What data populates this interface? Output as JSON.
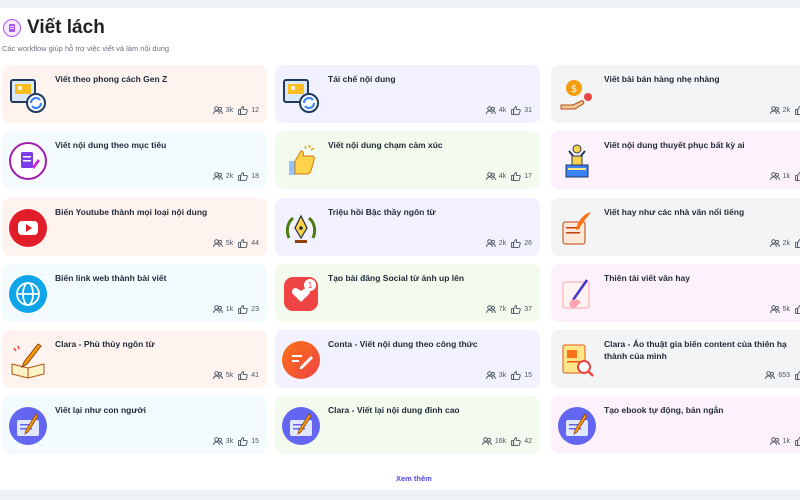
{
  "header": {
    "title": "Viết lách",
    "subtitle": "Các workflow giúp hỗ trợ việc viết và làm nội dung"
  },
  "cards": [
    {
      "title": "Viết theo phong cách Gen Z",
      "users": "3k",
      "likes": "12",
      "bg": "#fff3f0",
      "icon": "video-recycle-icon"
    },
    {
      "title": "Tái chế nội dung",
      "users": "4k",
      "likes": "31",
      "bg": "#f2f1ff",
      "icon": "video-recycle-icon"
    },
    {
      "title": "Viết bài bán hàng nhẹ nhàng",
      "users": "2k",
      "likes": "",
      "bg": "#f3f4f6",
      "icon": "money-hand-icon"
    },
    {
      "title": "Viết nội dung theo mục tiêu",
      "users": "2k",
      "likes": "18",
      "bg": "#f3fbff",
      "icon": "document-edit-icon"
    },
    {
      "title": "Viết nội dung chạm cảm xúc",
      "users": "4k",
      "likes": "17",
      "bg": "#f2fbee",
      "icon": "thumbs-up-icon"
    },
    {
      "title": "Viết nội dung thuyết phục bất kỳ ai",
      "users": "1k",
      "likes": "",
      "bg": "#fdf1fb",
      "icon": "speaker-podium-icon"
    },
    {
      "title": "Biến Youtube thành mọi loại nội dung",
      "users": "5k",
      "likes": "44",
      "bg": "#fff3f0",
      "icon": "youtube-icon"
    },
    {
      "title": "Triệu hồi Bậc thầy ngôn từ",
      "users": "2k",
      "likes": "26",
      "bg": "#f2f1ff",
      "icon": "pen-laurel-icon"
    },
    {
      "title": "Viết hay như các nhà văn nổi tiếng",
      "users": "2k",
      "likes": "",
      "bg": "#f3f4f6",
      "icon": "quill-paper-icon"
    },
    {
      "title": "Biến link web thành bài viết",
      "users": "1k",
      "likes": "23",
      "bg": "#f3fbff",
      "icon": "globe-icon"
    },
    {
      "title": "Tạo bài đăng Social từ ảnh up lên",
      "users": "7k",
      "likes": "37",
      "bg": "#f2fbee",
      "icon": "heart-notification-icon"
    },
    {
      "title": "Thiên tài viết văn hay",
      "users": "5k",
      "likes": "",
      "bg": "#fdf1fb",
      "icon": "hand-writing-icon"
    },
    {
      "title": "Clara - Phù thủy ngôn từ",
      "users": "5k",
      "likes": "41",
      "bg": "#fff3f0",
      "icon": "open-book-pencil-icon"
    },
    {
      "title": "Conta - Viết nội dung theo công thức",
      "users": "3k",
      "likes": "15",
      "bg": "#f2f1ff",
      "icon": "edit-circle-icon"
    },
    {
      "title": "Clara - Ảo thuật gia biến content của thiên hạ thành của mình",
      "users": "653",
      "likes": "",
      "bg": "#f3f4f6",
      "icon": "document-search-icon"
    },
    {
      "title": "Viết lại như con người",
      "users": "3k",
      "likes": "15",
      "bg": "#f3fbff",
      "icon": "notebook-pen-icon"
    },
    {
      "title": "Clara - Viết lại nội dung đỉnh cao",
      "users": "16k",
      "likes": "42",
      "bg": "#f2fbee",
      "icon": "notebook-pen-icon"
    },
    {
      "title": "Tạo ebook tự động, bản ngắn",
      "users": "1k",
      "likes": "",
      "bg": "#fdf1fb",
      "icon": "notebook-pen-icon"
    }
  ],
  "footer": {
    "more_label": "Xem thêm"
  }
}
